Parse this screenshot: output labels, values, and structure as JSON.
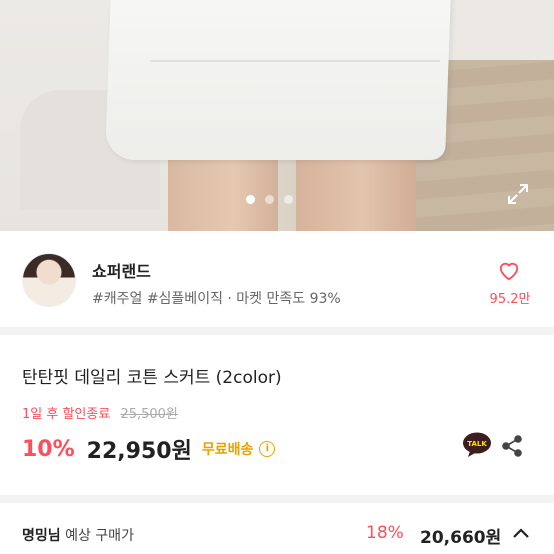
{
  "gallery": {
    "slide_count": 3,
    "active_slide": 1
  },
  "shop": {
    "name": "쇼퍼랜드",
    "tags": "#캐주얼 #심플베이직 · 마켓 만족도 93%",
    "likes": "95.2만"
  },
  "product": {
    "title": "탄탄핏 데일리 코튼 스커트 (2color)",
    "deal_label": "1일 후 할인종료",
    "original_price": "25,500원",
    "discount": "10%",
    "price": "22,950원",
    "shipping": "무료배송",
    "info_glyph": "i"
  },
  "member_bar": {
    "name": "명밍님",
    "label": "예상 구매가",
    "discount": "18%",
    "price": "20,660원"
  },
  "colors": {
    "accent": "#ff4d5a",
    "shipping": "#e8a200"
  }
}
